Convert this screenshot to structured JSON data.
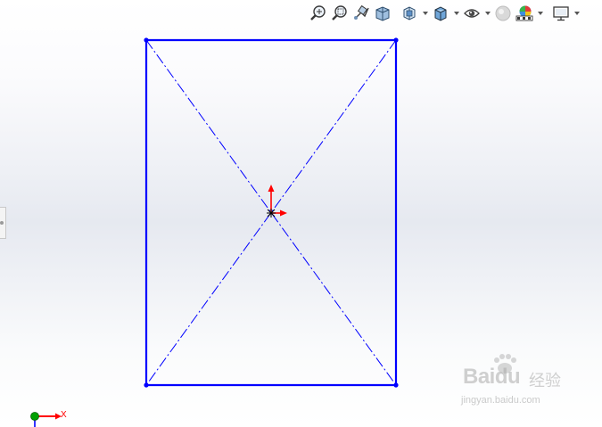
{
  "hud_toolbar": {
    "tools": [
      {
        "name": "zoom-to-fit-icon",
        "label": ""
      },
      {
        "name": "zoom-to-area-icon",
        "label": ""
      },
      {
        "name": "previous-view-icon",
        "label": ""
      },
      {
        "name": "section-view-icon",
        "label": ""
      },
      {
        "name": "view-orientation-icon",
        "label": ""
      },
      {
        "name": "display-style-icon",
        "label": ""
      },
      {
        "name": "hide-show-items-icon",
        "label": ""
      },
      {
        "name": "edit-appearance-icon",
        "label": ""
      },
      {
        "name": "apply-scene-icon",
        "label": ""
      },
      {
        "name": "view-settings-icon",
        "label": ""
      }
    ]
  },
  "sketch": {
    "line_color": "#0000ff",
    "point_color": "#0000ff",
    "origin_arrow_color": "#ff0000"
  },
  "triad": {
    "x_label": "X",
    "x_color": "#ff0000",
    "origin_color": "#00a000"
  },
  "watermark": {
    "brand": "Bai",
    "brand_suffix": "du",
    "brand_cn": "经验",
    "url": "jingyan.baidu.com"
  },
  "colors": {
    "background_top": "#ffffff",
    "background_mid": "#e6e9f0",
    "accent_blue": "#0000ff"
  }
}
